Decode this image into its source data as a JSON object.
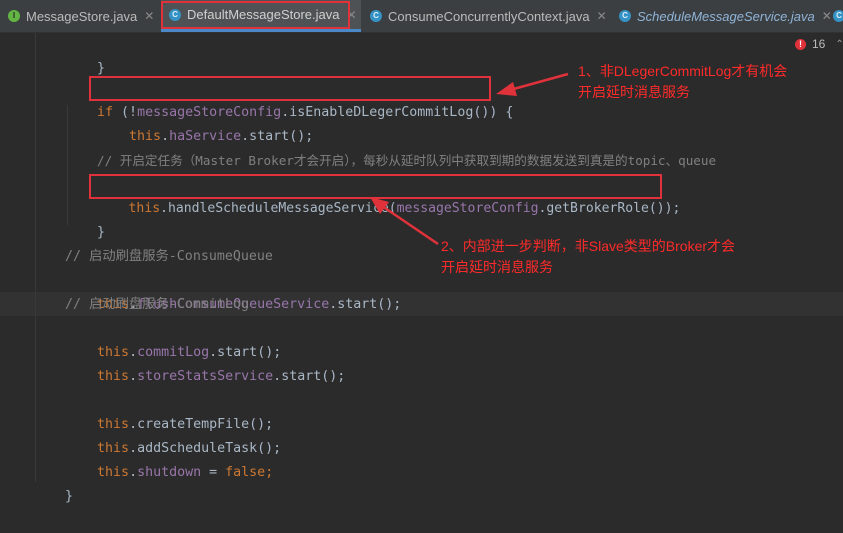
{
  "tabs": [
    {
      "label": "MessageStore.java",
      "icon": "I",
      "close": "✕"
    },
    {
      "label": "DefaultMessageStore.java",
      "icon": "C",
      "close": "✕"
    },
    {
      "label": "ConsumeConcurrentlyContext.java",
      "icon": "C",
      "close": "✕"
    },
    {
      "label": "ScheduleMessageService.java",
      "icon": "C",
      "close": "✕"
    },
    {
      "label": "",
      "icon": "C",
      "close": ""
    }
  ],
  "inspection": {
    "count": "16",
    "icon": "error-icon"
  },
  "code": {
    "l1": [
      "}"
    ],
    "l2": [
      "if",
      " (!",
      "messageStoreConfig",
      ".",
      "isEnableDLegerCommitLog",
      "()) {"
    ],
    "l3": [
      "this",
      ".",
      "haService",
      ".",
      "start",
      "();"
    ],
    "l4": [
      "// 开启定任务（Master Broker才会开启），每秒从延时队列中获取到期的数据发送到真是的topic、queue"
    ],
    "l5": [
      "this",
      ".",
      "handleScheduleMessageService",
      "(",
      "messageStoreConfig",
      ".",
      "getBrokerRole",
      "());"
    ],
    "l6": [
      "}"
    ],
    "l7": [
      "// 启动刷盘服务-ConsumeQueue"
    ],
    "l8": [
      "this",
      ".",
      "flushConsumeQueueService",
      ".",
      "start",
      "();"
    ],
    "l9": [
      "// 启动刷盘服务-CommitLog"
    ],
    "l10": [
      "this",
      ".",
      "commitLog",
      ".",
      "start",
      "();"
    ],
    "l11": [
      "this",
      ".",
      "storeStatsService",
      ".",
      "start",
      "();"
    ],
    "l12": [
      "this",
      ".",
      "createTempFile",
      "();"
    ],
    "l13": [
      "this",
      ".",
      "addScheduleTask",
      "();"
    ],
    "l14": [
      "this",
      ".",
      "shutdown",
      " = ",
      "false",
      ";"
    ],
    "l15": [
      "}"
    ]
  },
  "annotations": {
    "note1": "1、非DLegerCommitLog才有机会\n开启延时消息服务",
    "note2": "2、内部进一步判断，非Slave类型的Broker才会\n开启延时消息服务"
  },
  "colors": {
    "annotation": "#e0323a",
    "keyword": "#cc7832",
    "field": "#9876aa",
    "method": "#ffc66d",
    "comment": "#808080"
  }
}
